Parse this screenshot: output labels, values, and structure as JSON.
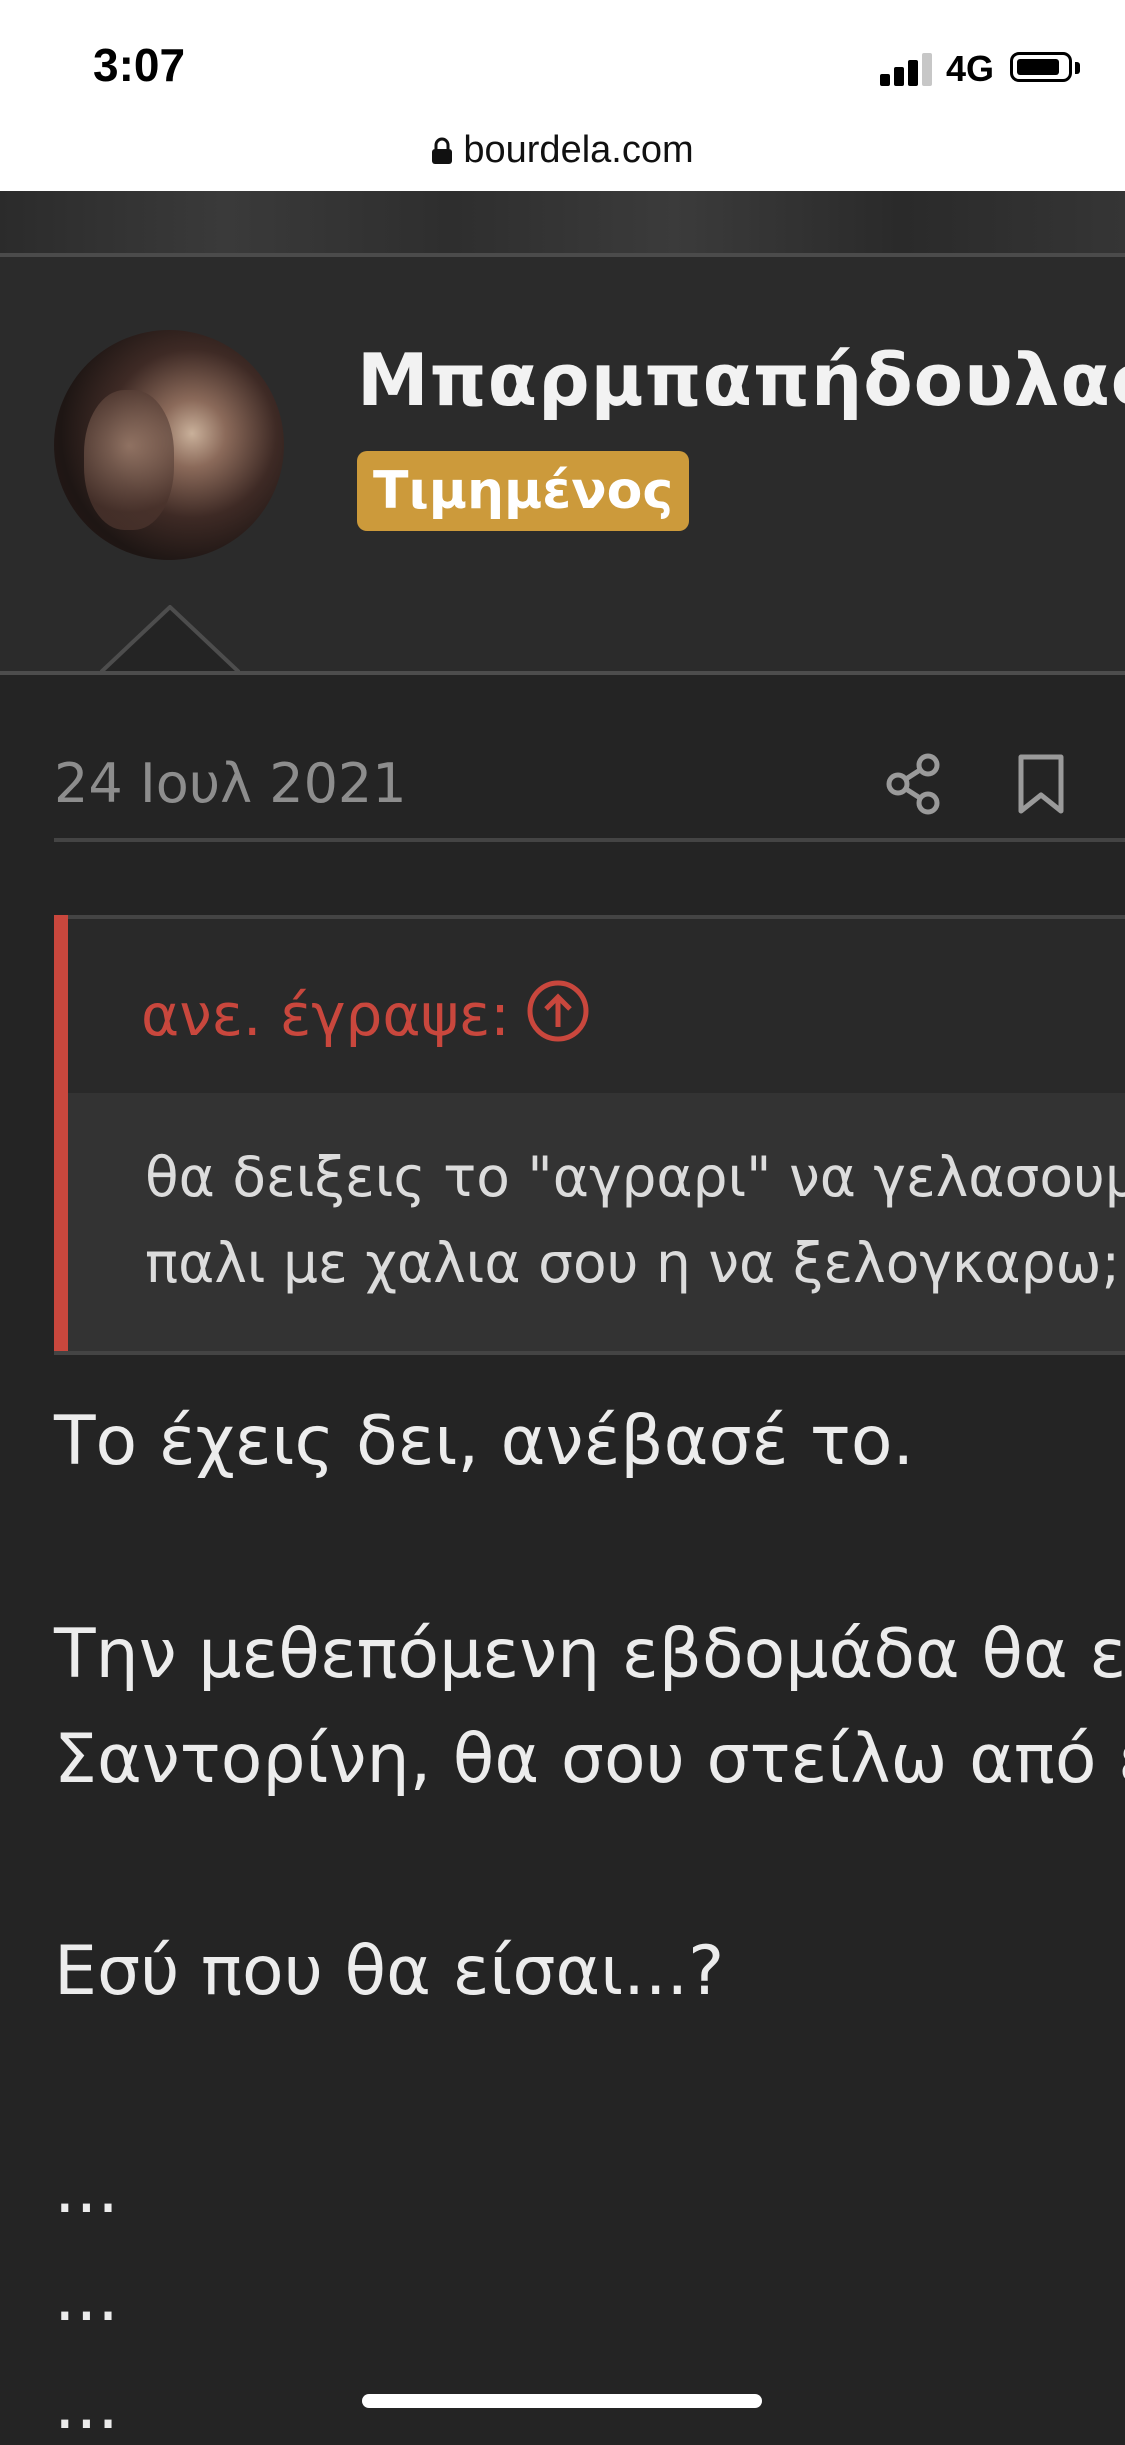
{
  "status_bar": {
    "time": "3:07",
    "network": "4G"
  },
  "browser": {
    "url": "bourdela.com"
  },
  "user": {
    "name": "Μπαρμπαπήδουλας",
    "rank": "Τιμημένος"
  },
  "post": {
    "date": "24 Ιουλ 2021",
    "quote": {
      "author": "ανε. έγραψε:",
      "lines": [
        "θα δειξεις το \"αγραρι\" να γελασουμε",
        "παλι με χαλια σου η να ξελογκαρω;"
      ]
    },
    "body_lines": [
      "Το έχεις δει, ανέβασέ το.",
      "Την μεθεπόμενη εβδομάδα θα ε",
      "Σαντορίνη, θα σου στείλω από ε",
      "Εσύ που θα είσαι...?",
      "...",
      "...",
      "..."
    ]
  },
  "icons": [
    "lock-icon",
    "share-icon",
    "bookmark-icon",
    "arrow-up-circle-icon"
  ],
  "colors": {
    "accent_red": "#c9473d",
    "badge_gold": "#cc9a3b",
    "background": "#242424"
  }
}
